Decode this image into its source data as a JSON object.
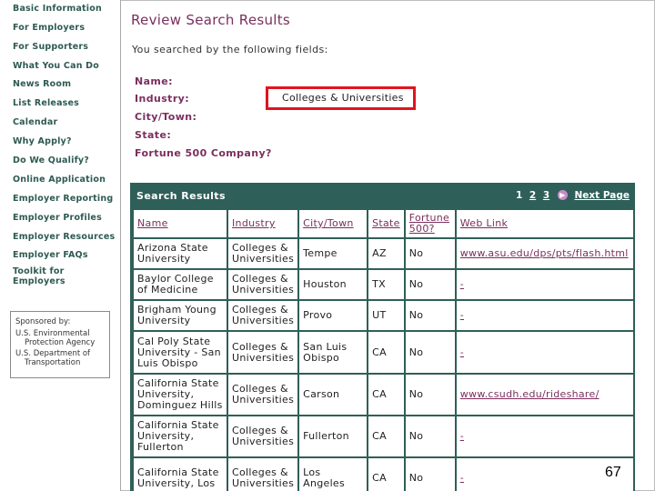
{
  "sidebar": {
    "items": [
      {
        "label": "Basic Information"
      },
      {
        "label": "For Employers"
      },
      {
        "label": "For Supporters"
      },
      {
        "label": "What You Can Do"
      },
      {
        "label": "News Room"
      },
      {
        "label": "List Releases"
      },
      {
        "label": "Calendar"
      },
      {
        "label": "Why Apply?"
      },
      {
        "label": "Do We Qualify?"
      },
      {
        "label": "Online Application"
      },
      {
        "label": "Employer Reporting"
      },
      {
        "label": "Employer Profiles"
      },
      {
        "label": "Employer Resources"
      },
      {
        "label": "Employer FAQs"
      },
      {
        "label": "Toolkit for Employers"
      }
    ],
    "sponsor": {
      "heading": "Sponsored by:",
      "lines": [
        "U.S. Environmental",
        "Protection Agency",
        "U.S. Department of",
        "Transportation"
      ]
    }
  },
  "main": {
    "title": "Review Search Results",
    "intro": "You searched by the following fields:",
    "fields": [
      {
        "label": "Name:",
        "value": ""
      },
      {
        "label": "Industry:",
        "value": "Colleges & Universities"
      },
      {
        "label": "City/Town:",
        "value": ""
      },
      {
        "label": "State:",
        "value": ""
      },
      {
        "label": "Fortune 500 Company?",
        "value": ""
      }
    ],
    "results": {
      "title": "Search Results",
      "pages": [
        "1",
        "2",
        "3"
      ],
      "next_label": "Next Page",
      "columns": [
        "Name",
        "Industry",
        "City/Town",
        "State",
        "Fortune 500?",
        "Web Link"
      ],
      "rows": [
        {
          "name": "Arizona State University",
          "industry": "Colleges & Universities",
          "city": "Tempe",
          "state": "AZ",
          "f500": "No",
          "link": "www.asu.edu/dps/pts/flash.html"
        },
        {
          "name": "Baylor College of Medicine",
          "industry": "Colleges & Universities",
          "city": "Houston",
          "state": "TX",
          "f500": "No",
          "link": "-"
        },
        {
          "name": "Brigham Young University",
          "industry": "Colleges & Universities",
          "city": "Provo",
          "state": "UT",
          "f500": "No",
          "link": "-"
        },
        {
          "name": "Cal Poly State University - San Luis Obispo",
          "industry": "Colleges & Universities",
          "city": "San Luis Obispo",
          "state": "CA",
          "f500": "No",
          "link": "-"
        },
        {
          "name": "California State University, Dominguez Hills",
          "industry": "Colleges & Universities",
          "city": "Carson",
          "state": "CA",
          "f500": "No",
          "link": "www.csudh.edu/rideshare/"
        },
        {
          "name": "California State University, Fullerton",
          "industry": "Colleges & Universities",
          "city": "Fullerton",
          "state": "CA",
          "f500": "No",
          "link": "-"
        },
        {
          "name": "California State University, Los",
          "industry": "Colleges & Universities",
          "city": "Los Angeles",
          "state": "CA",
          "f500": "No",
          "link": "-"
        }
      ]
    }
  },
  "slide_number": "67"
}
